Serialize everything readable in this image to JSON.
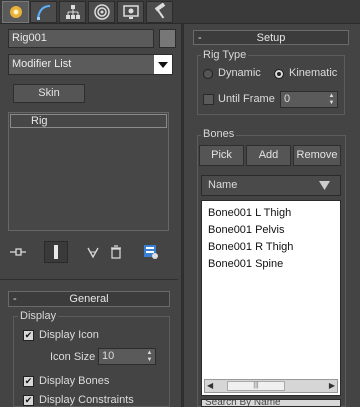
{
  "tabs": [
    {
      "name": "create-tab",
      "active": true
    },
    {
      "name": "modify-tab",
      "active": false
    },
    {
      "name": "hierarchy-tab",
      "active": false
    },
    {
      "name": "motion-tab",
      "active": false
    },
    {
      "name": "display-tab",
      "active": false
    },
    {
      "name": "utilities-tab",
      "active": false
    }
  ],
  "object": {
    "name": "Rig001"
  },
  "modifier_list": {
    "selected": "Modifier List"
  },
  "skin_button": "Skin",
  "stack": {
    "items": [
      "Rig"
    ]
  },
  "stack_toolbar": [
    "pin-stack-icon",
    "show-end-result-icon",
    "make-unique-icon",
    "remove-modifier-icon",
    "configure-modifier-sets-icon"
  ],
  "general": {
    "minus": "-",
    "title": "General",
    "display_group": "Display",
    "display_icon": {
      "label": "Display Icon",
      "checked": true
    },
    "icon_size": {
      "label": "Icon Size",
      "value": "10"
    },
    "display_bones": {
      "label": "Display Bones",
      "checked": true
    },
    "display_constraints": {
      "label": "Display Constraints",
      "checked": true
    }
  },
  "setup": {
    "minus": "-",
    "title": "Setup",
    "rig_type": {
      "label": "Rig Type",
      "dynamic": "Dynamic",
      "kinematic": "Kinematic",
      "selected": "Kinematic"
    },
    "until_frame": {
      "label": "Until Frame",
      "checked": false,
      "value": "0"
    }
  },
  "bones": {
    "label": "Bones",
    "pick": "Pick",
    "add": "Add",
    "remove": "Remove",
    "column_header": "Name",
    "items": [
      "Bone001 L Thigh",
      "Bone001 Pelvis",
      "Bone001 R Thigh",
      "Bone001 Spine"
    ],
    "search_placeholder": "Search By Name"
  },
  "colors": {
    "panel_bg": "#444444",
    "list_bg": "#ffffff",
    "accent_blue": "#4a90d9"
  }
}
